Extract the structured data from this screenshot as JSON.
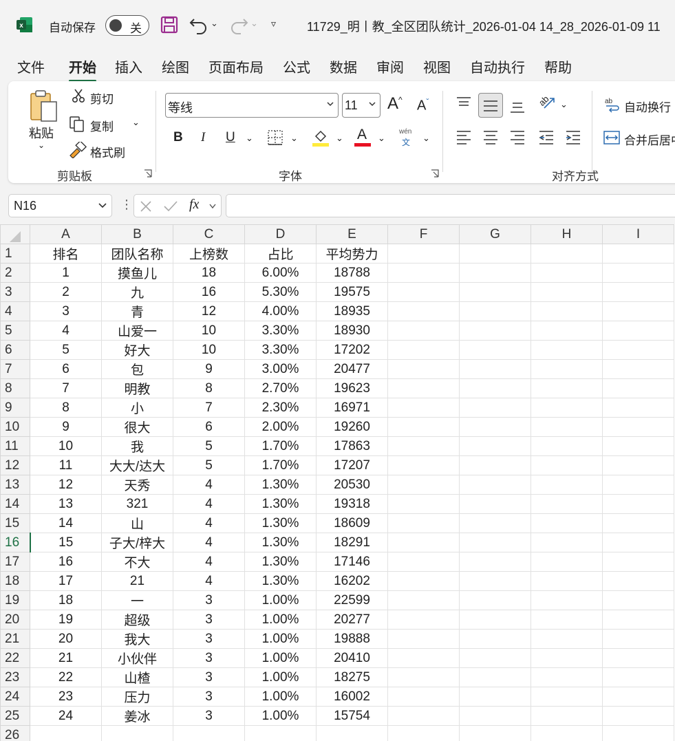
{
  "titlebar": {
    "autosave_label": "自动保存",
    "toggle_state": "关",
    "doc_title": "11729_明丨教_全区团队统计_2026-01-04 14_28_2026-01-09 11"
  },
  "menu": {
    "tabs": [
      "文件",
      "开始",
      "插入",
      "绘图",
      "页面布局",
      "公式",
      "数据",
      "审阅",
      "视图",
      "自动执行",
      "帮助"
    ],
    "active": "开始"
  },
  "ribbon": {
    "clipboard": {
      "paste": "粘贴",
      "cut": "剪切",
      "copy": "复制",
      "format_painter": "格式刷",
      "group": "剪贴板"
    },
    "font": {
      "font_name": "等线",
      "font_size": "11",
      "bold": "B",
      "italic": "I",
      "underline": "U",
      "group": "字体",
      "phonetic_top": "wén",
      "phonetic_bottom": "文",
      "font_color_letter": "A"
    },
    "alignment": {
      "wrap_text": "自动换行",
      "merge_center": "合并后居中",
      "group": "对齐方式",
      "orientation_text": "ab"
    },
    "colors": {
      "fill": "#ffeb3b",
      "font_color": "#e81123",
      "accent": "#1e7145"
    }
  },
  "formula_bar": {
    "name_box": "N16",
    "formula": ""
  },
  "sheet": {
    "columns": [
      "A",
      "B",
      "C",
      "D",
      "E",
      "F",
      "G",
      "H",
      "I"
    ],
    "selected_row": 16,
    "rows": [
      [
        "排名",
        "团队名称",
        "上榜数",
        "占比",
        "平均势力"
      ],
      [
        "1",
        "摸鱼儿",
        "18",
        "6.00%",
        "18788"
      ],
      [
        "2",
        "九",
        "16",
        "5.30%",
        "19575"
      ],
      [
        "3",
        "青",
        "12",
        "4.00%",
        "18935"
      ],
      [
        "4",
        "山爱一",
        "10",
        "3.30%",
        "18930"
      ],
      [
        "5",
        "好大",
        "10",
        "3.30%",
        "17202"
      ],
      [
        "6",
        "包",
        "9",
        "3.00%",
        "20477"
      ],
      [
        "7",
        "明教",
        "8",
        "2.70%",
        "19623"
      ],
      [
        "8",
        "小",
        "7",
        "2.30%",
        "16971"
      ],
      [
        "9",
        "很大",
        "6",
        "2.00%",
        "19260"
      ],
      [
        "10",
        "我",
        "5",
        "1.70%",
        "17863"
      ],
      [
        "11",
        "大大/达大",
        "5",
        "1.70%",
        "17207"
      ],
      [
        "12",
        "天秀",
        "4",
        "1.30%",
        "20530"
      ],
      [
        "13",
        "321",
        "4",
        "1.30%",
        "19318"
      ],
      [
        "14",
        "山",
        "4",
        "1.30%",
        "18609"
      ],
      [
        "15",
        "子大/梓大",
        "4",
        "1.30%",
        "18291"
      ],
      [
        "16",
        "不大",
        "4",
        "1.30%",
        "17146"
      ],
      [
        "17",
        "21",
        "4",
        "1.30%",
        "16202"
      ],
      [
        "18",
        "一",
        "3",
        "1.00%",
        "22599"
      ],
      [
        "19",
        "超级",
        "3",
        "1.00%",
        "20277"
      ],
      [
        "20",
        "我大",
        "3",
        "1.00%",
        "19888"
      ],
      [
        "21",
        "小伙伴",
        "3",
        "1.00%",
        "20410"
      ],
      [
        "22",
        "山楂",
        "3",
        "1.00%",
        "18275"
      ],
      [
        "23",
        "压力",
        "3",
        "1.00%",
        "16002"
      ],
      [
        "24",
        "姜冰",
        "3",
        "1.00%",
        "15754"
      ],
      [
        "",
        "",
        "",
        "",
        ""
      ]
    ]
  }
}
